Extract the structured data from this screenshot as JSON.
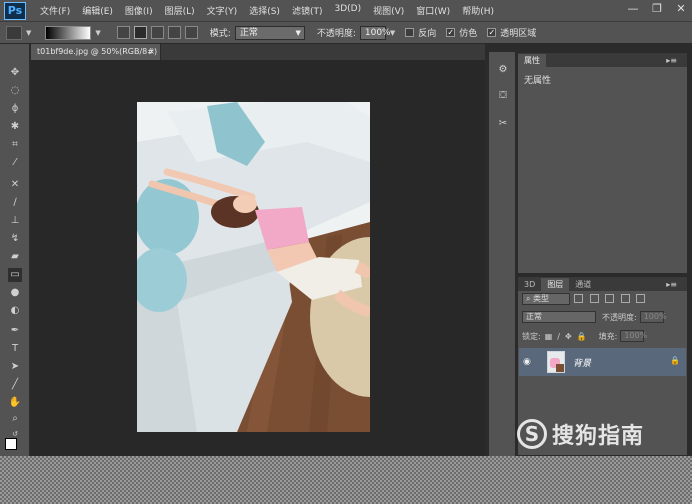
{
  "app": {
    "logo": "Ps"
  },
  "menu": [
    "文件(F)",
    "编辑(E)",
    "图像(I)",
    "图层(L)",
    "文字(Y)",
    "选择(S)",
    "滤镜(T)",
    "3D(D)",
    "视图(V)",
    "窗口(W)",
    "帮助(H)"
  ],
  "window_controls": {
    "minimize": "—",
    "restore": "❐",
    "close": "✕"
  },
  "options": {
    "mode_label": "模式:",
    "mode_value": "正常",
    "opacity_label": "不透明度:",
    "opacity_value": "100%",
    "reverse_label": "反向",
    "dither_label": "仿色",
    "transparency_label": "透明区域",
    "reverse_checked": false,
    "dither_checked": true,
    "transparency_checked": true
  },
  "document": {
    "tab_title": "t01bf9de.jpg @ 50%(RGB/8#)",
    "close": "×"
  },
  "properties_panel": {
    "tab": "属性",
    "content": "无属性"
  },
  "layers_panel": {
    "tabs": [
      "3D",
      "图层",
      "通道"
    ],
    "active_tab": "图层",
    "filter_value": "类型",
    "blend_mode": "正常",
    "opacity_label": "不透明度:",
    "opacity_value": "100%",
    "lock_label": "锁定:",
    "fill_label": "填充:",
    "fill_value": "100%",
    "layer_name": "背景"
  },
  "watermark": {
    "logo": "S",
    "text": "搜狗指南"
  },
  "colors": {
    "panel": "#535353",
    "canvas": "#282828",
    "layer_selected": "#59687b"
  }
}
